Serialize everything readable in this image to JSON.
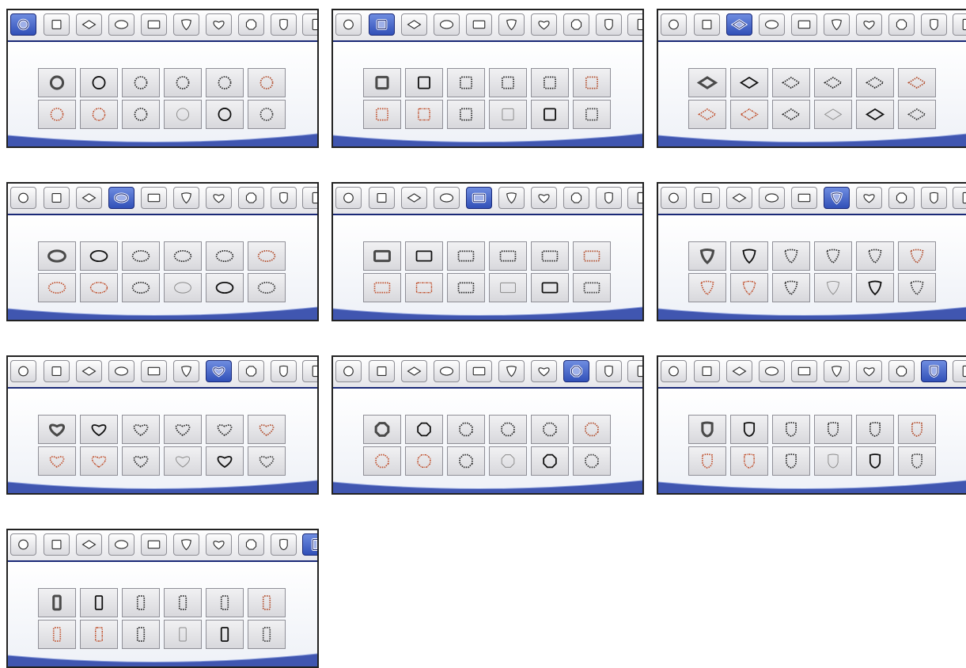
{
  "shapes": [
    "circle",
    "square",
    "diamond",
    "ellipse",
    "rectangle",
    "shield-point",
    "heart",
    "octagon",
    "shield",
    "tall-rectangle"
  ],
  "panels": [
    {
      "name": "circle-panel",
      "active": 0
    },
    {
      "name": "square-panel",
      "active": 1
    },
    {
      "name": "diamond-panel",
      "active": 2
    },
    {
      "name": "ellipse-panel",
      "active": 3
    },
    {
      "name": "rectangle-panel",
      "active": 4
    },
    {
      "name": "shield-point-panel",
      "active": 5
    },
    {
      "name": "heart-panel",
      "active": 6
    },
    {
      "name": "octagon-panel",
      "active": 7
    },
    {
      "name": "shield-panel",
      "active": 8
    },
    {
      "name": "tall-rectangle-panel",
      "active": 9
    }
  ],
  "frame_styles": [
    {
      "style": "thick-gray",
      "color": "#4a4a4a"
    },
    {
      "style": "solid",
      "color": "#111111"
    },
    {
      "style": "dotted",
      "color": "#222222"
    },
    {
      "style": "dotted",
      "color": "#222222"
    },
    {
      "style": "dotted",
      "color": "#222222"
    },
    {
      "style": "dotted",
      "color": "#b14a28"
    },
    {
      "style": "dotted",
      "color": "#c0502d"
    },
    {
      "style": "rough",
      "color": "#c0502d"
    },
    {
      "style": "dotted",
      "color": "#222222"
    },
    {
      "style": "thin",
      "color": "#8a8a8a"
    },
    {
      "style": "solid",
      "color": "#111111"
    },
    {
      "style": "dotted",
      "color": "#333333"
    }
  ],
  "colors": {
    "tabbar_border": "#1b2a78",
    "active_tab": "#3150b8",
    "swoosh": "#4056b0",
    "orange_frame": "#c0502d"
  }
}
